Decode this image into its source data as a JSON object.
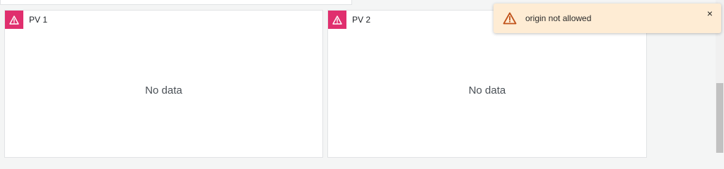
{
  "panels": [
    {
      "title": "PV 1",
      "empty_text": "No data"
    },
    {
      "title": "PV 2",
      "empty_text": "No data"
    }
  ],
  "toast": {
    "message": "origin not allowed",
    "close_symbol": "×",
    "icon": "warning-icon",
    "color": "#feecd4",
    "icon_color": "#c0521a"
  },
  "colors": {
    "warning_badge": "#e02f6e",
    "background": "#f4f5f5",
    "panel": "#ffffff"
  }
}
